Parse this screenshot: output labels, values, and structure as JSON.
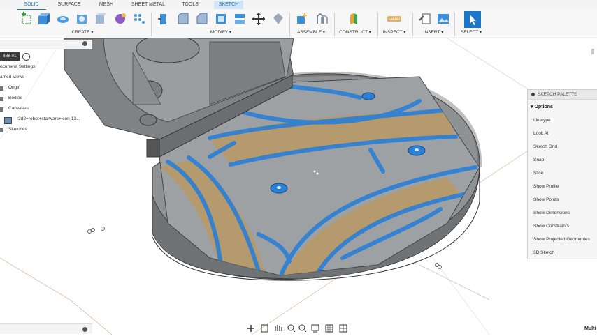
{
  "tabs": {
    "solid": "SOLID",
    "surface": "SURFACE",
    "mesh": "MESH",
    "sheet_metal": "SHEET METAL",
    "tools": "TOOLS",
    "sketch": "SKETCH"
  },
  "toolbar": {
    "create": "CREATE ▾",
    "modify": "MODIFY ▾",
    "assemble": "ASSEMBLE ▾",
    "construct": "CONSTRUCT ▾",
    "inspect": "INSPECT ▾",
    "insert": "INSERT ▾",
    "select": "SELECT ▾"
  },
  "browser": {
    "root": "888 v1",
    "items": [
      "ocument Settings",
      "amed Views",
      "Origin",
      "Bodies",
      "Canvases",
      "r2d2+robot+starwars+icon-13...",
      "Sketches"
    ]
  },
  "palette": {
    "title": "SKETCH PALETTE",
    "section": "Options",
    "items": [
      "Linetype",
      "Look At",
      "Sketch Grid",
      "Snap",
      "Slice",
      "Show Profile",
      "Show Points",
      "Show Dimensions",
      "Show Constraints",
      "Show Projected Geometries",
      "3D Sketch"
    ]
  },
  "status": {
    "right_text": "Multi"
  },
  "colors": {
    "accent": "#1b77c9",
    "sketch_blue": "#2a7fd6",
    "body_gray": "#8e9295",
    "tan": "#b59a6a"
  }
}
